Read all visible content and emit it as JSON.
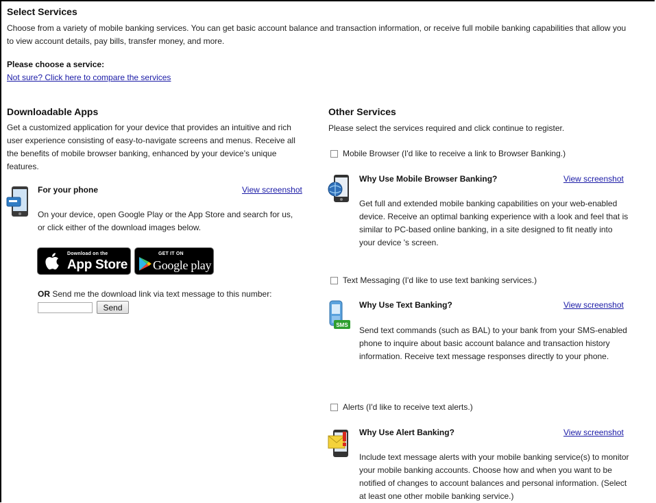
{
  "header": {
    "title": "Select Services",
    "intro": "Choose from a variety of mobile banking services. You can get basic account balance and transaction information, or receive full mobile banking capabilities that allow you to view account details, pay bills, transfer money, and more.",
    "choose_label": "Please choose a service:",
    "compare_link": "Not sure? Click here to compare the services"
  },
  "apps": {
    "title": "Downloadable Apps",
    "description": "Get a customized application for your device that provides an intuitive and rich user experience consisting of easy-to-navigate screens and menus. Receive all the benefits of mobile browser banking, enhanced by your device’s unique features.",
    "phone_title": "For your phone",
    "phone_screenshot_link": "View screenshot",
    "phone_text": "On your device, open Google Play or the App Store and search for us, or click either of the download images below.",
    "appstore_small": "Download on the",
    "appstore_big": "App Store",
    "googleplay_small": "GET IT ON",
    "googleplay_big": "Google play",
    "or_label": "OR",
    "sms_text": "Send me the download link via text message to this number:",
    "phone_input_value": "",
    "send_label": "Send"
  },
  "other": {
    "title": "Other Services",
    "instructions": "Please select the services required and click continue to register.",
    "services": [
      {
        "checkbox_label": "Mobile Browser (I'd like to receive a link to Browser Banking.)",
        "why_title": "Why Use Mobile Browser Banking?",
        "screenshot_link": "View screenshot",
        "description": "Get full and extended mobile banking capabilities on your web-enabled device. Receive an optimal banking experience with a look and feel that is similar to PC-based online banking, in a site designed to fit neatly into your device 's screen.",
        "icon": "mobile-browser-icon"
      },
      {
        "checkbox_label": "Text Messaging (I'd like to use text banking services.)",
        "why_title": "Why Use Text Banking?",
        "screenshot_link": "View screenshot",
        "description": "Send text commands (such as BAL) to your bank from your SMS-enabled phone to inquire about basic account balance and transaction history information. Receive text message responses directly to your phone.",
        "icon": "sms-phone-icon",
        "icon_badge": "SMS"
      },
      {
        "checkbox_label": "Alerts (I'd like to receive text alerts.)",
        "why_title": "Why Use Alert Banking?",
        "screenshot_link": "View screenshot",
        "description": "Include text message alerts with your mobile banking service(s) to monitor your mobile banking accounts. Choose how and when you want to be notified of changes to account balances and personal information. (Select at least one other mobile banking service.)",
        "icon": "alert-envelope-icon"
      }
    ]
  },
  "colors": {
    "link": "#1a1aa6",
    "text": "#222222",
    "store_button": "#000000",
    "sms_badge": "#2e9e2e"
  }
}
